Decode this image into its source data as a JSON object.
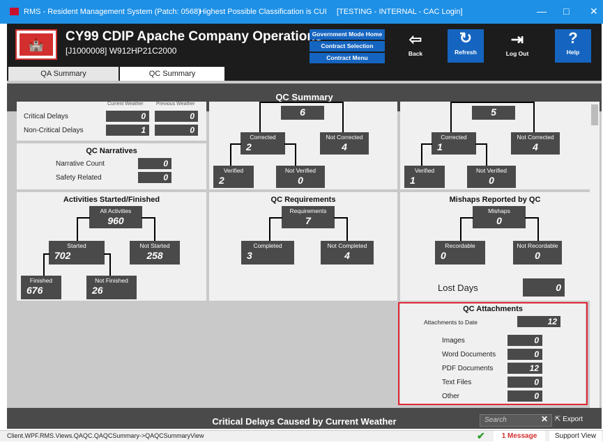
{
  "titlebar": {
    "app_title": "RMS - Resident Management System (Patch: 0568)",
    "classification": "Highest Possible Classification is CUI",
    "env": "[TESTING - INTERNAL - CAC Login]",
    "minimize": "—",
    "maximize": "□",
    "close": "✕"
  },
  "header": {
    "logo_text": "🏰",
    "title": "CY99 CDIP Apache Company Operations",
    "subtitle": "[J1000008] W912HP21C2000",
    "gov_mode_home": "Government Mode Home",
    "contract_selection": "Contract Selection",
    "contract_menu": "Contract Menu",
    "back_label": "Back",
    "refresh_label": "Refresh",
    "logout_label": "Log Out",
    "help_label": "Help"
  },
  "tabs": [
    {
      "label": "QA Summary",
      "active": false
    },
    {
      "label": "QC Summary",
      "active": true
    }
  ],
  "qc_summary": {
    "banner": "QC Summary",
    "weather": {
      "col1": "Current Weather",
      "col2": "Previous Weather",
      "rows": [
        {
          "label": "Critical Delays",
          "current": "0",
          "previous": "0"
        },
        {
          "label": "Non-Critical Delays",
          "current": "1",
          "previous": "0"
        }
      ]
    },
    "narratives": {
      "title": "QC Narratives",
      "rows": [
        {
          "label": "Narrative Count",
          "value": "0"
        },
        {
          "label": "Safety Related",
          "value": "0"
        }
      ]
    },
    "deficiencies_left": {
      "total": "6",
      "corrected_label": "Corrected",
      "corrected": "2",
      "not_corrected_label": "Not Corrected",
      "not_corrected": "4",
      "verified_label": "Verified",
      "verified": "2",
      "not_verified_label": "Not Verified",
      "not_verified": "0"
    },
    "deficiencies_right": {
      "total": "5",
      "corrected_label": "Corrected",
      "corrected": "1",
      "not_corrected_label": "Not Corrected",
      "not_corrected": "4",
      "verified_label": "Verified",
      "verified": "1",
      "not_verified_label": "Not Verified",
      "not_verified": "0"
    },
    "activities": {
      "title": "Activities Started/Finished",
      "all_label": "All Activities",
      "all": "960",
      "started_label": "Started",
      "started": "702",
      "not_started_label": "Not Started",
      "not_started": "258",
      "finished_label": "Finished",
      "finished": "676",
      "not_finished_label": "Not Finished",
      "not_finished": "26"
    },
    "requirements": {
      "title": "QC Requirements",
      "req_label": "Requirements",
      "req": "7",
      "completed_label": "Completed",
      "completed": "3",
      "not_completed_label": "Not Completed",
      "not_completed": "4"
    },
    "mishaps": {
      "title": "Mishaps Reported by QC",
      "mishaps_label": "Mishaps",
      "mishaps": "0",
      "recordable_label": "Recordable",
      "recordable": "0",
      "not_recordable_label": "Not Recordable",
      "not_recordable": "0",
      "lost_days_label": "Lost Days",
      "lost_days": "0"
    },
    "attachments": {
      "title": "QC Attachments",
      "to_date_label": "Attachments to Date",
      "to_date": "12",
      "rows": [
        {
          "label": "Images",
          "value": "0"
        },
        {
          "label": "Word Documents",
          "value": "0"
        },
        {
          "label": "PDF Documents",
          "value": "12"
        },
        {
          "label": "Text Files",
          "value": "0"
        },
        {
          "label": "Other",
          "value": "0"
        }
      ]
    },
    "critical_banner": "Critical Delays Caused by Current Weather",
    "search_placeholder": "Search",
    "search_clear": "✕",
    "export_label": "Export"
  },
  "statusbar": {
    "view_path": "Client.WPF.RMS.Views.QAQC.QAQCSummary->QAQCSummaryView",
    "message": "1 Message",
    "support": "Support View"
  },
  "colors": {
    "titlebar": "#1e90e6",
    "header": "#1c1c1c",
    "accent_button": "#1565c0",
    "value_box": "#4a4a4a",
    "highlight_border": "#e32636"
  }
}
